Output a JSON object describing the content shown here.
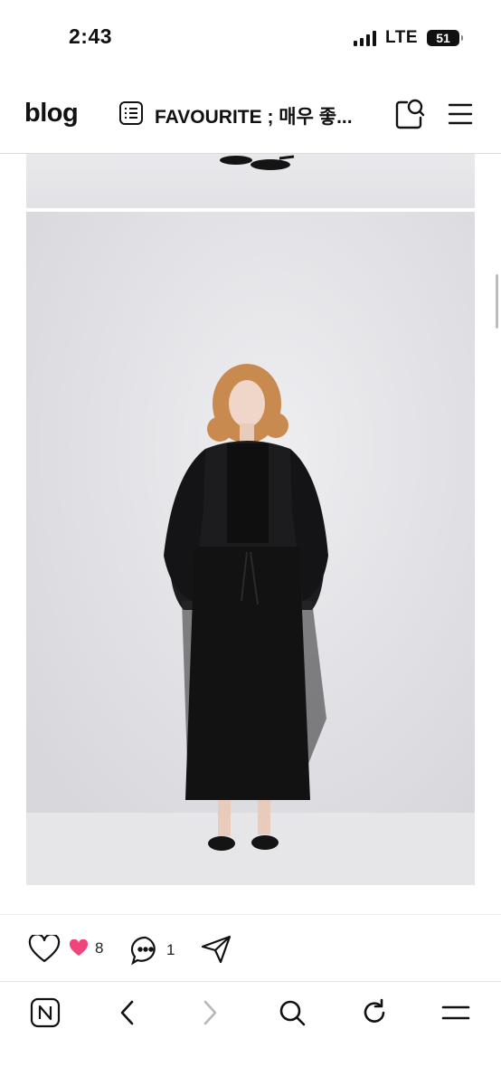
{
  "status_bar": {
    "time": "2:43",
    "network": "LTE",
    "battery": "51"
  },
  "header": {
    "logo": "blog",
    "post_title": "FAVOURITE ; 매우 좋...",
    "icons": [
      "list-icon",
      "search-icon",
      "menu-icon"
    ]
  },
  "content": {
    "images": [
      "fashion-photo-partial",
      "fashion-photo-model-black-outfit"
    ]
  },
  "actions": {
    "like_label": "like",
    "reaction_count": "8",
    "comment_count": "1",
    "share_label": "share"
  },
  "browser_toolbar": {
    "items": [
      "naver-home-icon",
      "back-icon",
      "forward-icon",
      "search-icon",
      "reload-icon",
      "menu-icon"
    ]
  },
  "colors": {
    "heart_accent": "#f0457a",
    "forward_disabled": "#b7b7b7",
    "text": "#111111"
  }
}
